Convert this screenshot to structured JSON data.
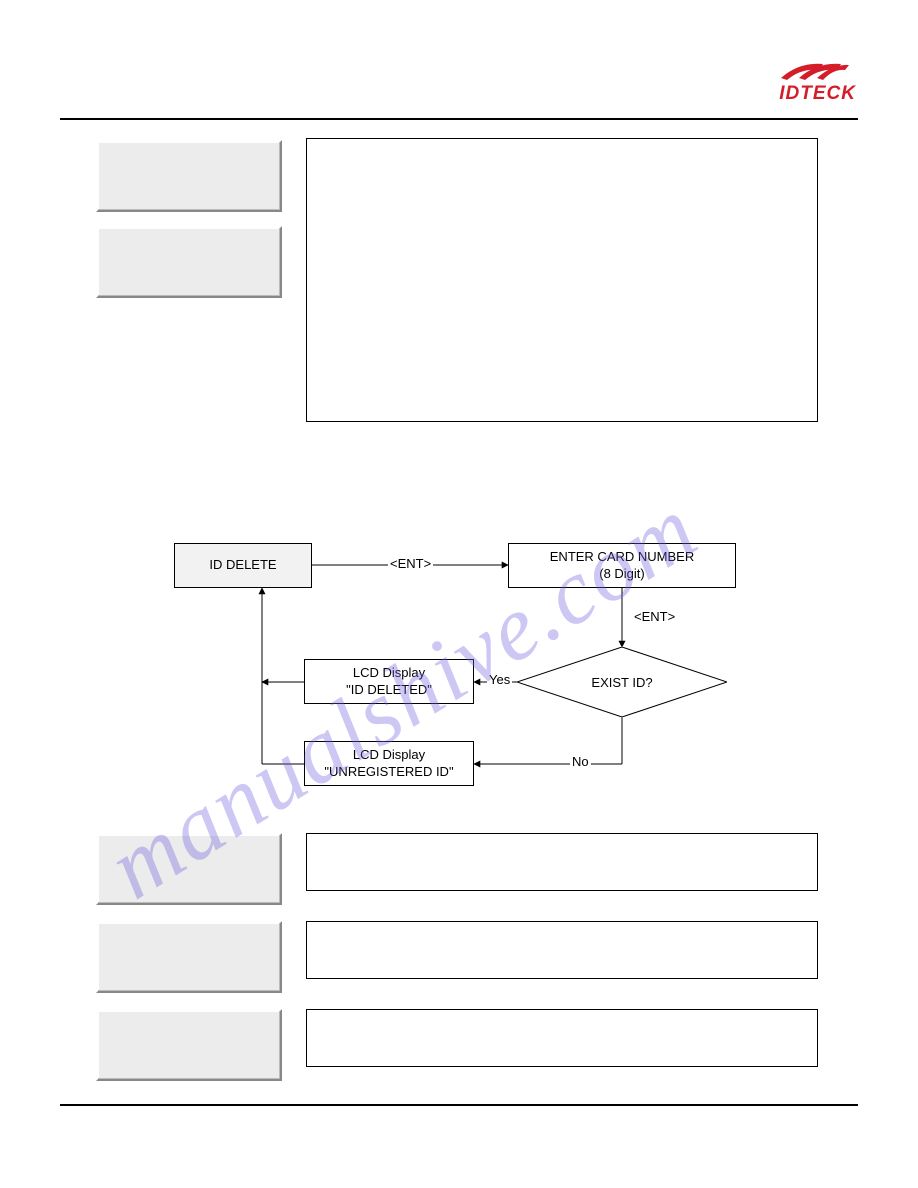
{
  "logo": {
    "brand": "IDTECK"
  },
  "watermark": "manualshive.com",
  "flow": {
    "start": "ID DELETE",
    "ent1": "<ENT>",
    "enter_card_l1": "ENTER CARD NUMBER",
    "enter_card_l2": "(8 Digit)",
    "ent2": "<ENT>",
    "decision": "EXIST ID?",
    "yes": "Yes",
    "no": "No",
    "lcd_yes_l1": "LCD Display",
    "lcd_yes_l2": "\"ID DELETED\"",
    "lcd_no_l1": "LCD Display",
    "lcd_no_l2": "\"UNREGISTERED ID\""
  },
  "chart_data": {
    "type": "flowchart",
    "nodes": [
      {
        "id": "id_delete",
        "type": "process-shaded",
        "label": "ID DELETE"
      },
      {
        "id": "enter_card",
        "type": "process",
        "label": "ENTER CARD NUMBER (8 Digit)"
      },
      {
        "id": "exist_id",
        "type": "decision",
        "label": "EXIST ID?"
      },
      {
        "id": "lcd_deleted",
        "type": "process",
        "label": "LCD Display \"ID DELETED\""
      },
      {
        "id": "lcd_unreg",
        "type": "process",
        "label": "LCD Display \"UNREGISTERED ID\""
      }
    ],
    "edges": [
      {
        "from": "id_delete",
        "to": "enter_card",
        "label": "<ENT>"
      },
      {
        "from": "enter_card",
        "to": "exist_id",
        "label": "<ENT>"
      },
      {
        "from": "exist_id",
        "to": "lcd_deleted",
        "label": "Yes"
      },
      {
        "from": "exist_id",
        "to": "lcd_unreg",
        "label": "No"
      },
      {
        "from": "lcd_deleted",
        "to": "id_delete",
        "label": ""
      },
      {
        "from": "lcd_unreg",
        "to": "id_delete",
        "label": ""
      }
    ]
  }
}
